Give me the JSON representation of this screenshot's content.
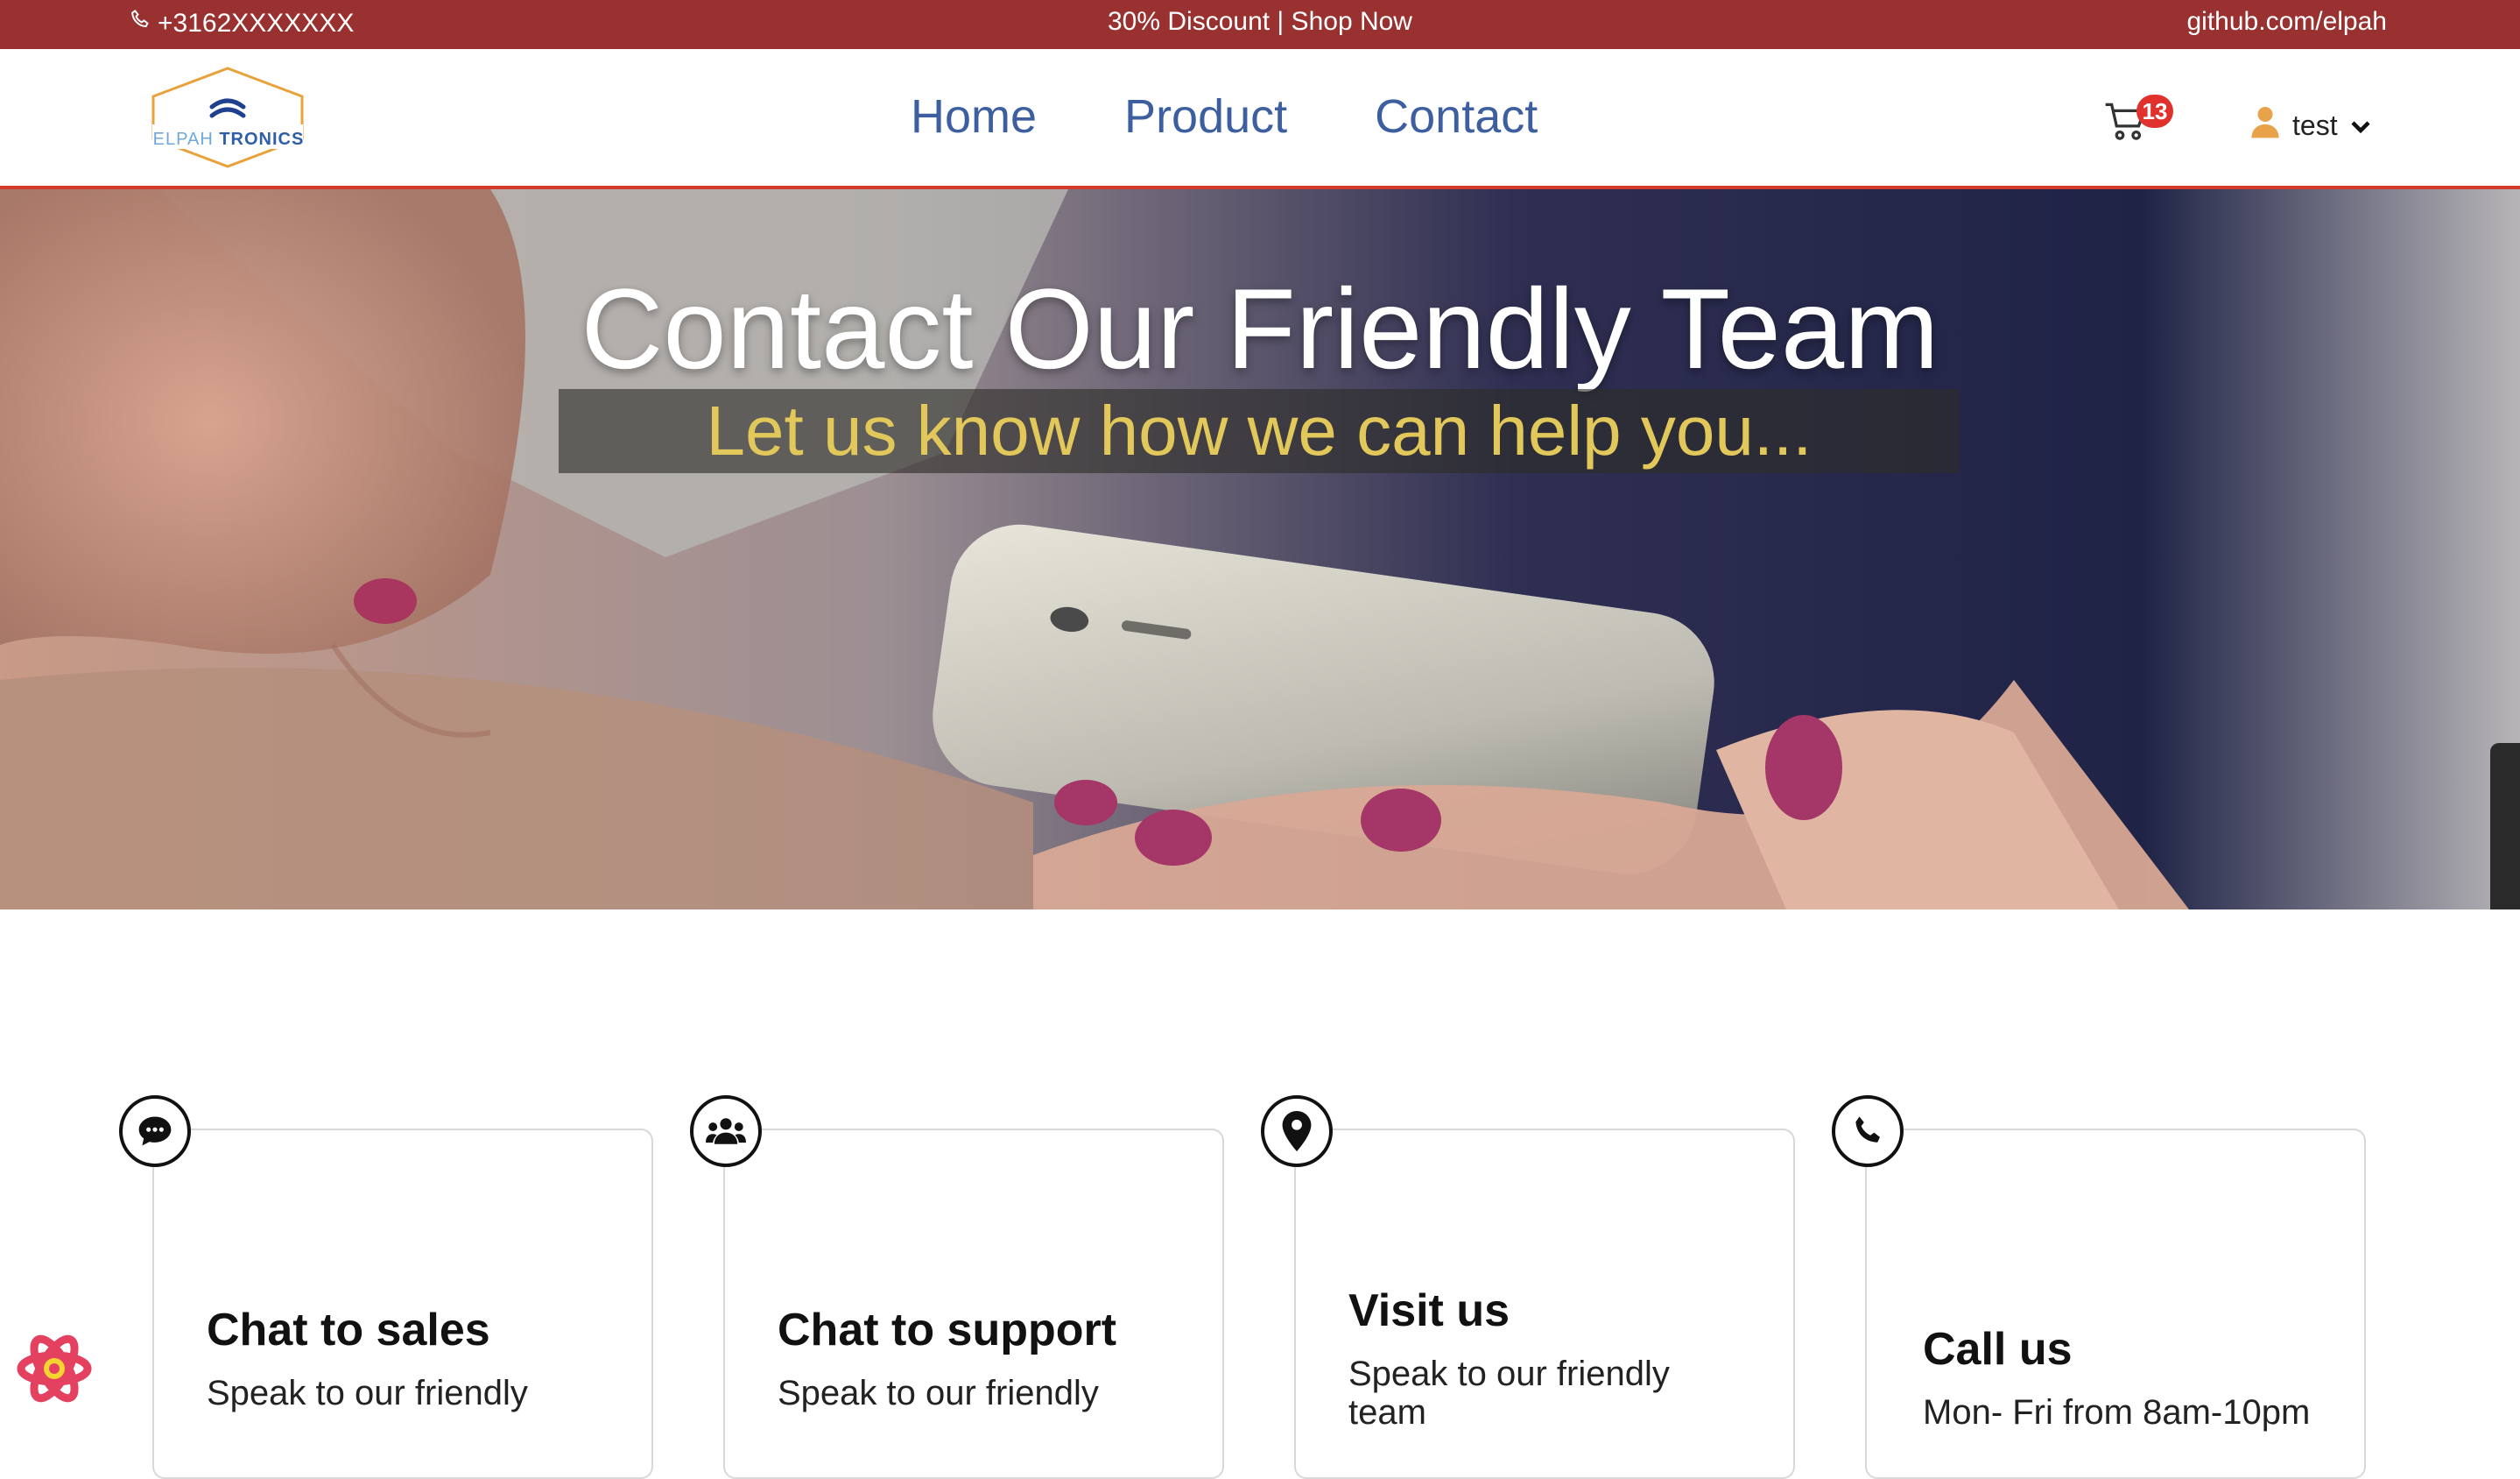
{
  "topbar": {
    "phone": "+3162XXXXXXX",
    "promo": "30% Discount | Shop Now",
    "github": "github.com/elpah"
  },
  "logo": {
    "part1": "ELPAH",
    "part2": "TRONICS"
  },
  "nav": {
    "items": [
      {
        "label": "Home"
      },
      {
        "label": "Product"
      },
      {
        "label": "Contact"
      }
    ]
  },
  "cart": {
    "count": "13",
    "icon": "cart-icon"
  },
  "user": {
    "name": "test",
    "icon": "user-icon"
  },
  "hero": {
    "title": "Contact Our Friendly Team",
    "subtitle": "Let us know how we can help you..."
  },
  "cards": [
    {
      "icon": "chat-bubble-icon",
      "title": "Chat to sales",
      "desc": "Speak to our friendly"
    },
    {
      "icon": "users-icon",
      "title": "Chat to support",
      "desc": "Speak to our friendly"
    },
    {
      "icon": "location-pin-icon",
      "title": "Visit us",
      "desc": "Speak to our friendly team"
    },
    {
      "icon": "phone-icon",
      "title": "Call us",
      "desc": "Mon- Fri from 8am-10pm"
    }
  ],
  "colors": {
    "topbar": "#9a3131",
    "nav_link": "#3d5fa0",
    "accent_border": "#d23b2b",
    "hero_subtitle": "#e2c85a",
    "badge": "#e0312c",
    "user_icon": "#e7a24a"
  }
}
